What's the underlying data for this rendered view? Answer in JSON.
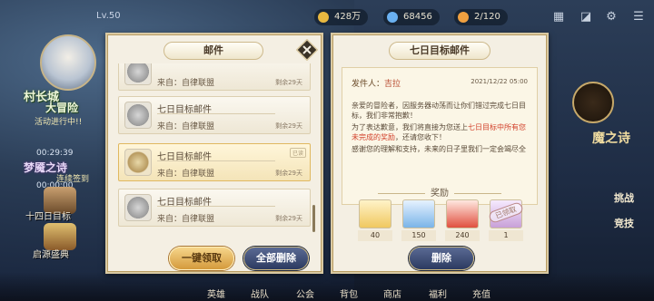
{
  "topbar": {
    "level": "Lv.50",
    "resources": [
      {
        "name": "gold",
        "value": "428万",
        "color": "#e8b840"
      },
      {
        "name": "diamond",
        "value": "68456",
        "color": "#6ab0f0"
      },
      {
        "name": "stamina",
        "value": "2/120",
        "color": "#f0a040"
      }
    ]
  },
  "left_sidebar": {
    "event1_title": "村长城",
    "event1_sub": "大冒险",
    "event1_status": "活动进行中!!",
    "timer": "00:29:39",
    "event2_title": "梦魇之诗",
    "event2_sub": "连续签到",
    "timer2": "00:00:00",
    "item1": "十四日目标",
    "item2": "启源盛典"
  },
  "right_menu": {
    "title": "魔之诗",
    "challenge": "挑战",
    "compete": "竞技"
  },
  "bottom_nav": [
    "英雄",
    "战队",
    "公会",
    "背包",
    "商店",
    "福利",
    "充值"
  ],
  "mail_panel": {
    "title": "邮件",
    "mails": [
      {
        "title": "",
        "from": "来自：自律联盟",
        "remaining": "剩余29天",
        "selected": false
      },
      {
        "title": "七日目标邮件",
        "from": "来自：自律联盟",
        "remaining": "剩余29天",
        "selected": false
      },
      {
        "title": "七日目标邮件",
        "from": "来自：自律联盟",
        "remaining": "剩余29天",
        "selected": true
      },
      {
        "title": "七日目标邮件",
        "from": "来自：自律联盟",
        "remaining": "剩余29天",
        "selected": false
      }
    ],
    "badge": "已读",
    "claim_all": "一键领取",
    "delete_all": "全部删除"
  },
  "detail_panel": {
    "title": "七日目标邮件",
    "sender_label": "发件人：",
    "sender_name": "吉拉",
    "date": "2021/12/22 05:00",
    "para1": "亲爱的冒险者，因服务器动荡而让你们错过完成七日目标，我们非常抱歉！",
    "para2_a": "为了表达歉意，我们将直接为您送上",
    "para2_red": "七日目标中所有您未完成的奖励",
    "para2_b": "，还请您收下！",
    "para3": "感谢您的理解和支持，未来的日子里我们一定会竭尽全",
    "rewards_label": "奖励",
    "rewards": [
      {
        "qty": "40",
        "color": "#f0c860"
      },
      {
        "qty": "150",
        "color": "#7ab4e8"
      },
      {
        "qty": "240",
        "color": "#e05040"
      },
      {
        "qty": "1",
        "color": "#c8a0d8"
      }
    ],
    "claimed_stamp": "已领取",
    "delete_label": "删除"
  }
}
